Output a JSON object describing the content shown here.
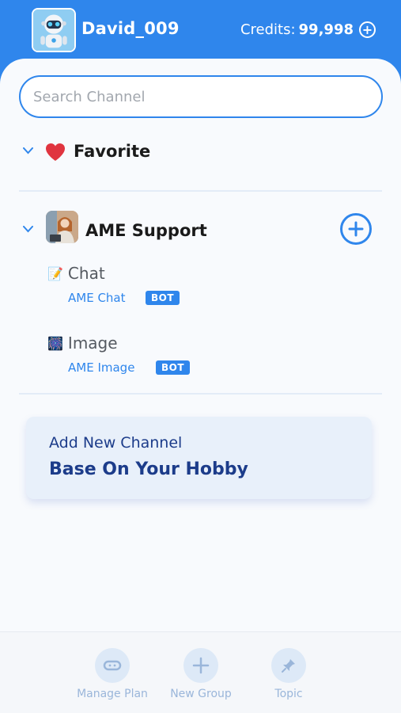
{
  "header": {
    "username": "David_009",
    "credits_label": "Credits:",
    "credits_value": "99,998"
  },
  "search": {
    "placeholder": "Search Channel"
  },
  "favorite": {
    "title": "Favorite"
  },
  "group": {
    "title": "AME Support",
    "channels": [
      {
        "name": "Chat",
        "emoji": "📝",
        "bot_name": "AME Chat",
        "badge": "BOT"
      },
      {
        "name": "Image",
        "emoji": "🎆",
        "bot_name": "AME Image",
        "badge": "BOT"
      }
    ]
  },
  "promo": {
    "subtitle": "Add New Channel",
    "title": "Base On Your Hobby"
  },
  "bottom_nav": {
    "items": [
      {
        "label": "Manage Plan",
        "icon": "manage-plan-icon"
      },
      {
        "label": "New Group",
        "icon": "plus-icon"
      },
      {
        "label": "Topic",
        "icon": "pin-icon"
      }
    ]
  },
  "colors": {
    "accent": "#2f86ec",
    "heart": "#e0343f",
    "promo_text": "#1c3c8a"
  }
}
